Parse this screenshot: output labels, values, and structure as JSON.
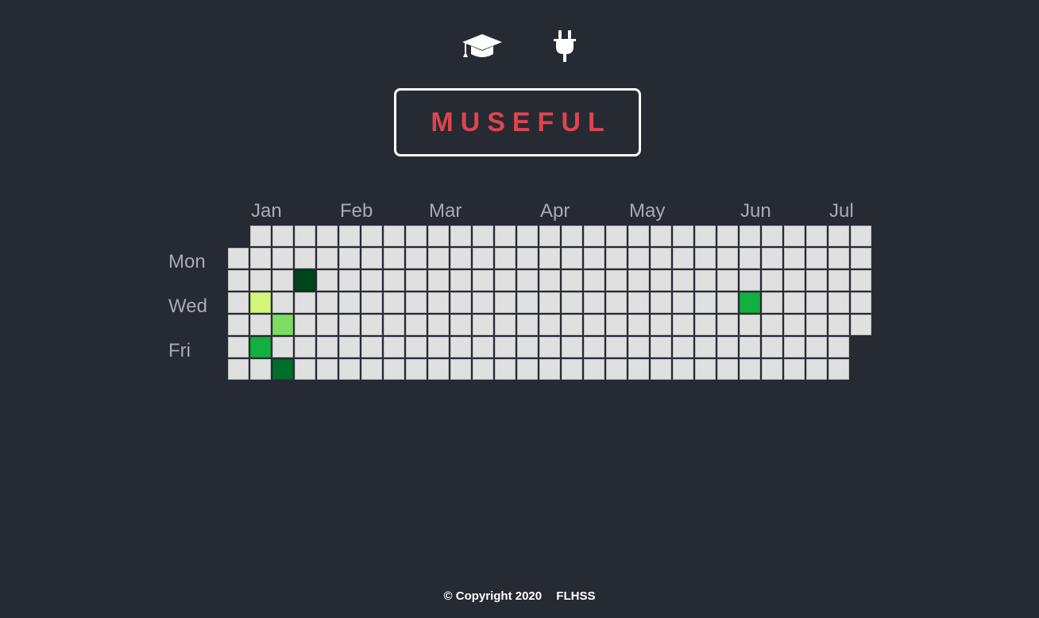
{
  "nav": {
    "icons": [
      "graduation-cap-icon",
      "plug-icon"
    ]
  },
  "logo": {
    "text": "MUSEFUL",
    "color": "#e0444e"
  },
  "calendar": {
    "months": [
      "Jan",
      "Feb",
      "Mar",
      "Apr",
      "May",
      "Jun",
      "Jul"
    ],
    "days": [
      "Mon",
      "Wed",
      "Fri"
    ],
    "empty_color": "#e0e0e0",
    "activity": [
      {
        "week": 3,
        "day": 2,
        "color": "#00441b"
      },
      {
        "week": 1,
        "day": 3,
        "color": "#d2f57a"
      },
      {
        "week": 23,
        "day": 3,
        "color": "#12b041"
      },
      {
        "week": 2,
        "day": 4,
        "color": "#7ddc62"
      },
      {
        "week": 1,
        "day": 5,
        "color": "#12b041"
      },
      {
        "week": 2,
        "day": 6,
        "color": "#006d2c"
      }
    ]
  },
  "footer": {
    "copyright": "© Copyright 2020",
    "org": "FLHSS"
  }
}
